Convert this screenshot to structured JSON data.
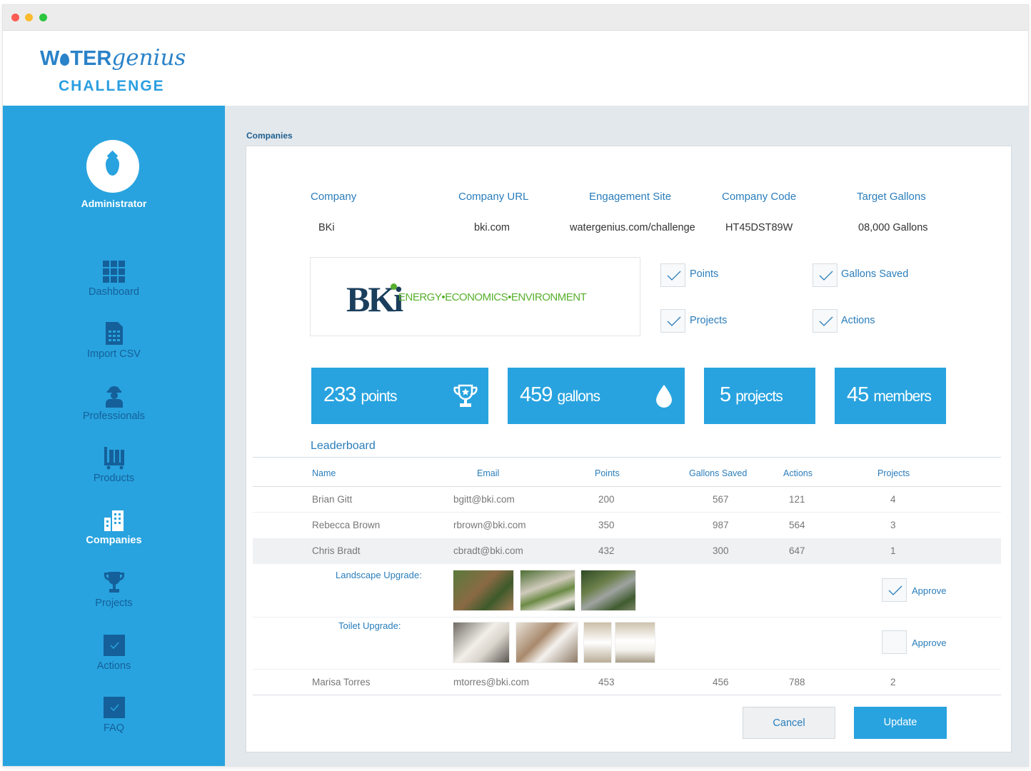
{
  "brand": {
    "logo_word": "WATER",
    "logo_genius": "genius",
    "logo_sub": "CHALLENGE"
  },
  "sidebar": {
    "role": "Administrator",
    "items": [
      {
        "label": "Dashboard",
        "icon": "grid-icon"
      },
      {
        "label": "Import CSV",
        "icon": "spreadsheet-icon"
      },
      {
        "label": "Professionals",
        "icon": "worker-icon"
      },
      {
        "label": "Products",
        "icon": "cart-icon"
      },
      {
        "label": "Companies",
        "icon": "building-icon",
        "active": true
      },
      {
        "label": "Projects",
        "icon": "trophy-icon"
      },
      {
        "label": "Actions",
        "icon": "checkbox-icon"
      },
      {
        "label": "FAQ",
        "icon": "checkbox-icon"
      }
    ]
  },
  "section_title": "Companies",
  "company": {
    "headers": {
      "company": "Company",
      "url": "Company URL",
      "site": "Engagement Site",
      "code": "Company Code",
      "target": "Target Gallons"
    },
    "values": {
      "company": "BKi",
      "url": "bki.com",
      "site": "watergenius.com/challenge",
      "code": "HT45DST89W",
      "target": "08,000 Gallons"
    },
    "logo": {
      "mark": "BKi",
      "tagline": "ENERGY•ECONOMICS•ENVIRONMENT"
    }
  },
  "options": [
    {
      "label": "Points",
      "checked": true
    },
    {
      "label": "Gallons Saved",
      "checked": true
    },
    {
      "label": "Projects",
      "checked": true
    },
    {
      "label": "Actions",
      "checked": true
    }
  ],
  "stats": [
    {
      "value": "233",
      "unit": "points",
      "icon": "trophy-icon"
    },
    {
      "value": "459",
      "unit": "gallons",
      "icon": "drop-icon"
    },
    {
      "value": "5",
      "unit": "projects"
    },
    {
      "value": "45",
      "unit": "members"
    }
  ],
  "leaderboard": {
    "title": "Leaderboard",
    "columns": [
      "Name",
      "Email",
      "Points",
      "Gallons Saved",
      "Actions",
      "Projects"
    ],
    "rows": [
      [
        "Brian Gitt",
        "bgitt@bki.com",
        "200",
        "567",
        "121",
        "4"
      ],
      [
        "Rebecca Brown",
        "rbrown@bki.com",
        "350",
        "987",
        "564",
        "3"
      ],
      [
        "Chris Bradt",
        "cbradt@bki.com",
        "432",
        "300",
        "647",
        "1"
      ],
      [
        "Marisa Torres",
        "mtorres@bki.com",
        "453",
        "456",
        "788",
        "2"
      ]
    ],
    "projects": [
      {
        "label": "Landscape Upgrade:",
        "approve": "Approve",
        "approved": true
      },
      {
        "label": "Toilet Upgrade:",
        "approve": "Approve",
        "approved": false
      }
    ]
  },
  "buttons": {
    "cancel": "Cancel",
    "update": "Update"
  },
  "colors": {
    "accent": "#28a3df",
    "link": "#2a7dbb",
    "nav_text": "#15609a",
    "brand_green": "#57b02c"
  }
}
